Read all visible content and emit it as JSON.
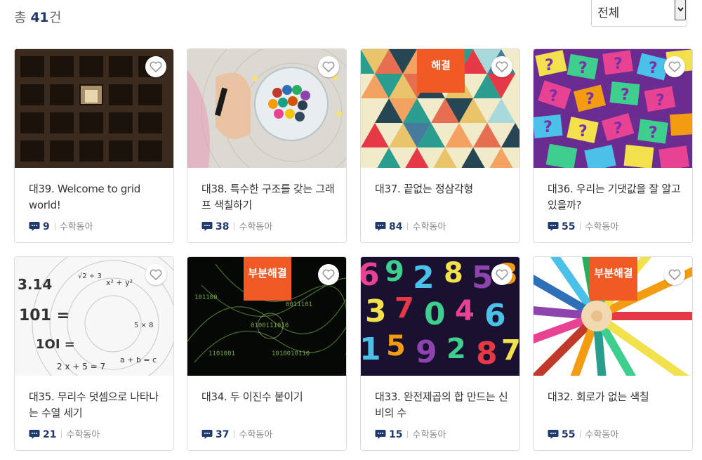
{
  "header": {
    "total_prefix": "총",
    "total_count": "41",
    "total_suffix": "건",
    "filter": {
      "selected": "전체"
    }
  },
  "cards": [
    {
      "title": "대39. Welcome to grid world!",
      "comments": "9",
      "author": "수학동아",
      "badge": "",
      "thumb_icon": "grid-shelves-image"
    },
    {
      "title": "대38. 특수한 구조를 갖는 그래프 색칠하기",
      "comments": "38",
      "author": "수학동아",
      "badge": "",
      "thumb_icon": "crayons-coloring-image"
    },
    {
      "title": "대37. 끝없는 정삼각형",
      "comments": "84",
      "author": "수학동아",
      "badge": "해결",
      "thumb_icon": "triangle-pattern-image"
    },
    {
      "title": "대36. 우리는 기댓값을 잘 알고 있을까?",
      "comments": "55",
      "author": "수학동아",
      "badge": "",
      "thumb_icon": "question-marks-image"
    },
    {
      "title": "대35. 무리수 덧셈으로 나타나는 수열 세기",
      "comments": "21",
      "author": "수학동아",
      "badge": "",
      "thumb_icon": "math-formulas-image"
    },
    {
      "title": "대34. 두 이진수 붙이기",
      "comments": "37",
      "author": "수학동아",
      "badge": "부분해결",
      "thumb_icon": "binary-stream-image"
    },
    {
      "title": "대33. 완전제곱의 합 만드는 신비의 수",
      "comments": "15",
      "author": "수학동아",
      "badge": "",
      "thumb_icon": "colorful-numbers-image"
    },
    {
      "title": "대32. 회로가 없는 색칠",
      "comments": "55",
      "author": "수학동아",
      "badge": "부분해결",
      "thumb_icon": "colored-pencils-image"
    }
  ],
  "colors": {
    "accent_navy": "#1e3a6e",
    "badge_orange": "#f15a24"
  }
}
